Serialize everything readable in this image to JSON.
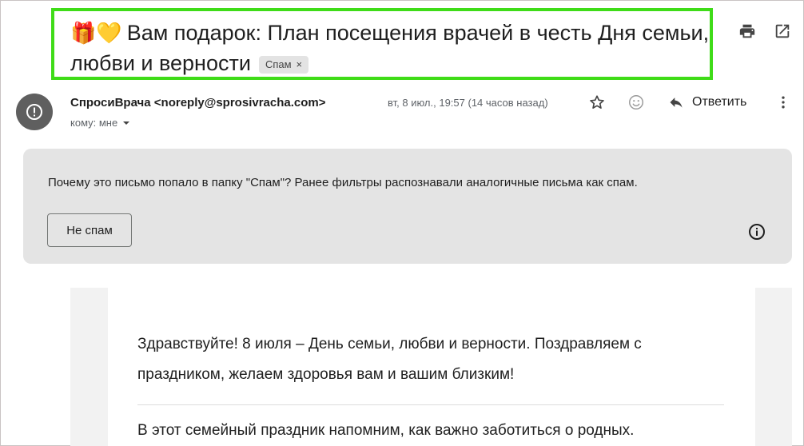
{
  "subject": {
    "emoji": "🎁💛",
    "text": "Вам подарок: План посещения врачей в честь Дня семьи, любви и верности",
    "spam_label": "Спам",
    "spam_remove": "×"
  },
  "toolbar": {
    "print_icon": "printer-icon",
    "open_new_window_icon": "open-in-new-icon"
  },
  "sender": {
    "name": "СпросиВрача",
    "email": "<noreply@sprosivracha.com>",
    "date": "вт, 8 июл., 19:57 (14 часов назад)",
    "to": "кому: мне",
    "reply_label": "Ответить"
  },
  "warning": {
    "question": "Почему это письмо попало в папку \"Спам\"?",
    "reason": " Ранее фильтры распознавали аналогичные письма как спам.",
    "not_spam_button": "Не спам"
  },
  "body": {
    "paragraph1_line1": "Здравствуйте! 8 июля – День семьи, любви и верности. Поздравляем с",
    "paragraph1_line2": "праздником, желаем здоровья вам и вашим близким!",
    "paragraph2_line1": "В этот семейный праздник напомним, как важно заботиться о родных."
  },
  "colors": {
    "highlight_border": "#3fdc18",
    "avatar_bg": "#5f5f5f",
    "warning_bg": "#e4e4e4"
  }
}
